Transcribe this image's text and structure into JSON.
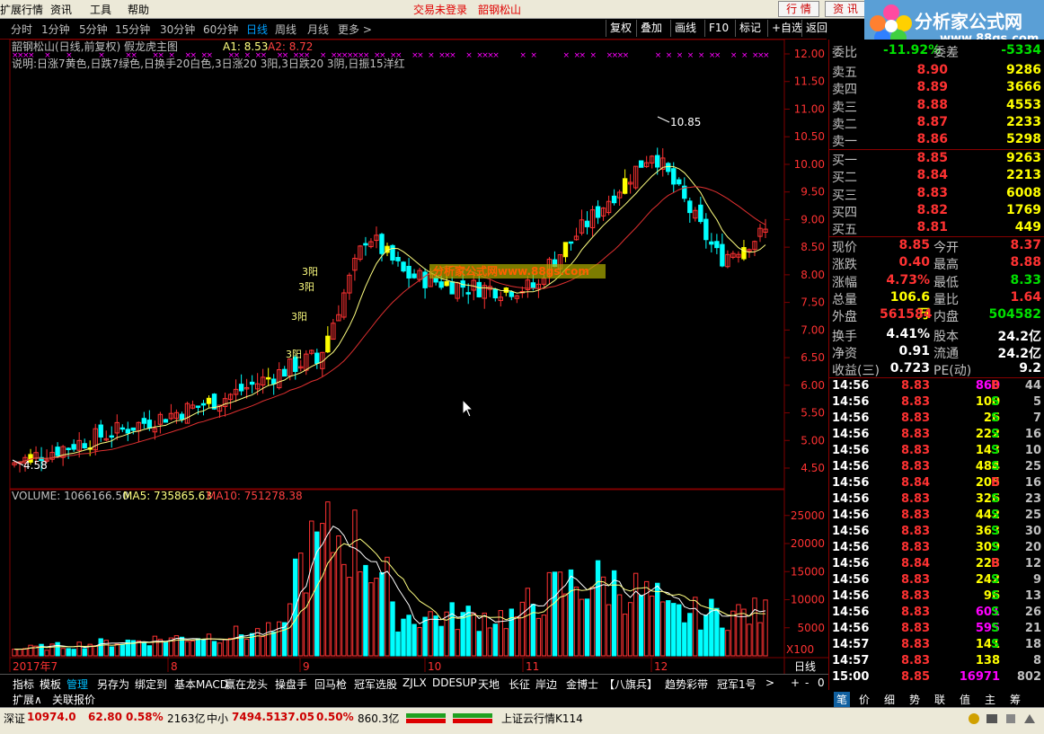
{
  "menu": {
    "items": [
      "扩展行情",
      "资讯",
      "工具",
      "帮助"
    ],
    "status1": "交易未登录",
    "status2": "韶钢松山",
    "btn1": "行 情",
    "btn2": "资 讯"
  },
  "logo": {
    "text": "分析家公式网",
    "url": "www.88gs.com"
  },
  "timeframes": [
    "分时",
    "1分钟",
    "5分钟",
    "15分钟",
    "30分钟",
    "60分钟",
    "日线",
    "周线",
    "月线",
    "更多 >"
  ],
  "active_timeframe": "日线",
  "right_buttons": [
    "复权",
    "叠加",
    "画线",
    "F10",
    "标记",
    "+自选",
    "返回"
  ],
  "chart_title": "韶钢松山(日线,前复权) 假龙虎主图",
  "a1": "A1: 8.53",
  "a2": "A2: 8.72",
  "desc": "说明:日涨7黄色,日跌7绿色,日换手20白色,3日涨20 3阳,3日跌20 3阴,日振15洋红",
  "watermark": "分析家公式网www.88gs.com",
  "max_label": "10.85",
  "min_label": "4.58",
  "sanyang_labels": [
    "3阳",
    "3阳",
    "3阳",
    "3阳"
  ],
  "volume_title": "VOLUME: 1066166.50",
  "ma5": "MA5: 735865.63",
  "ma10": "MA10: 751278.38",
  "vol_unit": "X100",
  "price_axis": [
    "12.00",
    "11.50",
    "11.00",
    "10.50",
    "10.00",
    "9.50",
    "9.00",
    "8.50",
    "8.00",
    "7.50",
    "7.00",
    "6.50",
    "6.00",
    "5.50",
    "5.00",
    "4.50"
  ],
  "vol_axis": [
    "25000",
    "20000",
    "15000",
    "10000",
    "5000"
  ],
  "date_axis": [
    "2017年7",
    "8",
    "9",
    "10",
    "11",
    "12"
  ],
  "period_label": "日线",
  "quote": {
    "weibi_label": "委比",
    "weibi": "-11.92%",
    "weicha_label": "委差",
    "weicha": "-5334",
    "asks": [
      {
        "label": "卖五",
        "price": "8.90",
        "vol": "9286"
      },
      {
        "label": "卖四",
        "price": "8.89",
        "vol": "3666"
      },
      {
        "label": "卖三",
        "price": "8.88",
        "vol": "4553"
      },
      {
        "label": "卖二",
        "price": "8.87",
        "vol": "2233"
      },
      {
        "label": "卖一",
        "price": "8.86",
        "vol": "5298"
      }
    ],
    "bids": [
      {
        "label": "买一",
        "price": "8.85",
        "vol": "9263"
      },
      {
        "label": "买二",
        "price": "8.84",
        "vol": "2213"
      },
      {
        "label": "买三",
        "price": "8.83",
        "vol": "6008"
      },
      {
        "label": "买四",
        "price": "8.82",
        "vol": "1769"
      },
      {
        "label": "买五",
        "price": "8.81",
        "vol": "449"
      }
    ],
    "stats": [
      {
        "l1": "现价",
        "v1": "8.85",
        "l2": "今开",
        "v2": "8.37"
      },
      {
        "l1": "涨跌",
        "v1": "0.40",
        "l2": "最高",
        "v2": "8.88"
      },
      {
        "l1": "涨幅",
        "v1": "4.73%",
        "l2": "最低",
        "v2": "8.33"
      },
      {
        "l1": "总量",
        "v1": "106.6万",
        "l2": "量比",
        "v2": "1.64"
      },
      {
        "l1": "外盘",
        "v1": "561584",
        "l2": "内盘",
        "v2": "504582"
      },
      {
        "l1": "换手",
        "v1": "4.41%",
        "l2": "股本",
        "v2": "24.2亿"
      },
      {
        "l1": "净资",
        "v1": "0.91",
        "l2": "流通",
        "v2": "24.2亿"
      },
      {
        "l1": "收益(三)",
        "v1": "0.723",
        "l2": "PE(动)",
        "v2": "9.2"
      }
    ]
  },
  "ticks": [
    {
      "t": "14:56",
      "p": "8.83",
      "v": "860",
      "s": "B",
      "n": "44"
    },
    {
      "t": "14:56",
      "p": "8.83",
      "v": "100",
      "s": "S",
      "n": "5"
    },
    {
      "t": "14:56",
      "p": "8.83",
      "v": "26",
      "s": "S",
      "n": "7"
    },
    {
      "t": "14:56",
      "p": "8.83",
      "v": "222",
      "s": "S",
      "n": "16"
    },
    {
      "t": "14:56",
      "p": "8.83",
      "v": "143",
      "s": "S",
      "n": "10"
    },
    {
      "t": "14:56",
      "p": "8.83",
      "v": "484",
      "s": "S",
      "n": "25"
    },
    {
      "t": "14:56",
      "p": "8.84",
      "v": "205",
      "s": "B",
      "n": "16"
    },
    {
      "t": "14:56",
      "p": "8.83",
      "v": "326",
      "s": "S",
      "n": "23"
    },
    {
      "t": "14:56",
      "p": "8.83",
      "v": "442",
      "s": "S",
      "n": "25"
    },
    {
      "t": "14:56",
      "p": "8.83",
      "v": "363",
      "s": "S",
      "n": "30"
    },
    {
      "t": "14:56",
      "p": "8.83",
      "v": "309",
      "s": "S",
      "n": "20"
    },
    {
      "t": "14:56",
      "p": "8.84",
      "v": "223",
      "s": "B",
      "n": "12"
    },
    {
      "t": "14:56",
      "p": "8.83",
      "v": "242",
      "s": "S",
      "n": "9"
    },
    {
      "t": "14:56",
      "p": "8.83",
      "v": "96",
      "s": "S",
      "n": "13"
    },
    {
      "t": "14:56",
      "p": "8.83",
      "v": "601",
      "s": "S",
      "n": "26"
    },
    {
      "t": "14:56",
      "p": "8.83",
      "v": "595",
      "s": "S",
      "n": "21"
    },
    {
      "t": "14:57",
      "p": "8.83",
      "v": "141",
      "s": "S",
      "n": "18"
    },
    {
      "t": "14:57",
      "p": "8.83",
      "v": "138",
      "s": "",
      "n": "8"
    },
    {
      "t": "15:00",
      "p": "8.85",
      "v": "16971",
      "s": "",
      "n": "802"
    }
  ],
  "bottom_tabs": [
    "指标",
    "模板",
    "管理",
    "另存为",
    "绑定到",
    "基本MACD",
    "赢在龙头",
    "操盘手",
    "回马枪",
    "冠军选股",
    "ZJLX",
    "DDE",
    "SUP",
    "天地",
    "长征",
    "岸边",
    "金博士",
    "【八旗兵】",
    "趋势彩带",
    "冠军1号"
  ],
  "active_bottom_tab": "管理",
  "sub_tabs": [
    "扩展∧",
    "关联报价"
  ],
  "right_tabs": [
    "笔",
    "价",
    "细",
    "势",
    "联",
    "值",
    "主",
    "筹"
  ],
  "status": {
    "idx1_name": "深证",
    "idx1_val": "10974.0",
    "idx1_chg": "62.80",
    "idx1_pct": "0.58%",
    "idx1_amt": "2163亿",
    "idx2_name": "中小",
    "idx2_val": "7494.51",
    "idx2_chg": "37.05",
    "idx2_pct": "0.50%",
    "idx2_amt": "860.3亿",
    "server": "上证云行情K114"
  },
  "colors": {
    "up": "#ff3232",
    "down": "#00ffff",
    "ma5": "#ffff80",
    "ma10": "#e03030",
    "yellow": "#ffff00",
    "grid": "#800000"
  }
}
